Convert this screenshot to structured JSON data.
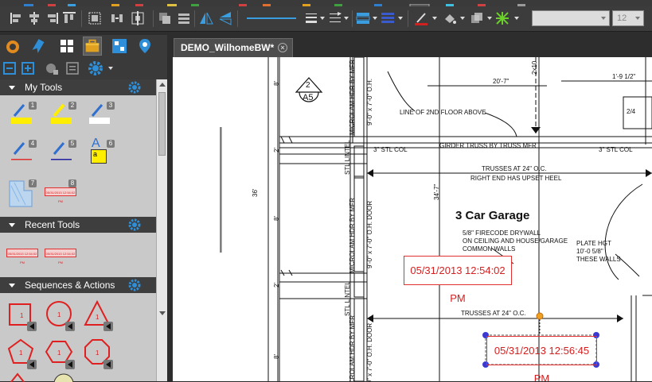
{
  "document_tab": {
    "title": "DEMO_WilhomeBW*",
    "close_symbol": "×"
  },
  "toolbar": {
    "font_combo": "",
    "size_combo": "12"
  },
  "sidebar": {
    "sections": [
      {
        "title": "My Tools"
      },
      {
        "title": "Recent Tools"
      },
      {
        "title": "Sequences & Actions"
      }
    ],
    "my_tools_badges": [
      "1",
      "2",
      "3",
      "4",
      "5",
      "6",
      "7",
      "8"
    ],
    "tool6_letter": "A",
    "tool6_sub": "a",
    "sequence_badges": [
      "1",
      "1",
      "1",
      "1",
      "1",
      "1"
    ],
    "stamp_thumb_label": "05/31/2013 12:54:02 PM"
  },
  "drawing": {
    "labels": {
      "section_num": "2",
      "section_sheet": "A5",
      "dim_20_7": "20'-7\"",
      "dim_2x10": "2x10",
      "dim_1_9": "1'-9 1/2\"",
      "dim_2_4": "2/4",
      "line_2nd_floor": "LINE OF 2ND FLOOR ABOVE",
      "girder": "GIRDER TRUSS BY TRUSS MFR",
      "stl_col_left": "3\" STL COL",
      "stl_col_right": "3\" STL COL",
      "trusses_24": "TRUSSES AT 24\" O.C.",
      "right_end": "RIGHT END HAS UPSET HEEL",
      "dim_34_7": "34'-7\"",
      "room_title": "3 Car Garage",
      "drywall_1": "5/8\" FIRECODE DRYWALL",
      "drywall_2": "ON CEILING AND HOUSE/GARAGE",
      "drywall_3": "COMMON WALLS",
      "plate_1": "PLATE HGT",
      "plate_2": "10'-0 5/8\"",
      "plate_3": "THESE WALLS",
      "trusses_24_b": "TRUSSES AT 24\" O.C.",
      "dim_8_a": "8'",
      "dim_2_a": "2'",
      "dim_8_b": "8'",
      "dim_2_b": "2'",
      "dim_8_c": "8'",
      "dim_36": "36'",
      "v_microlam_1": "MICROLAM HDR BY MFR",
      "v_door_1": "9'-0\" x 7'-0\" O.H.",
      "v_stl_lintel_1": "STL LINTEL",
      "v_microlam_2": "MICROLAM HDR BY MFR",
      "v_door_2": "9'-0\" x 7'-0\" O.H. DOOR",
      "v_stl_lintel_2": "STL LINTEL",
      "v_door_3": "9'-0\" x 7'-0\" O.H. DOOR",
      "v_microlam_3": "MICROLAM HDR BY MFR"
    },
    "stamps": [
      {
        "text": "05/31/2013 12:54:02 PM"
      },
      {
        "text": "05/31/2013 12:56:45 PM"
      }
    ]
  },
  "colors": {
    "stamp_red": "#d42020",
    "handle_blue": "#3a3ad0",
    "handle_orange": "#f0a020",
    "accent_blue": "#2e8fd8"
  }
}
